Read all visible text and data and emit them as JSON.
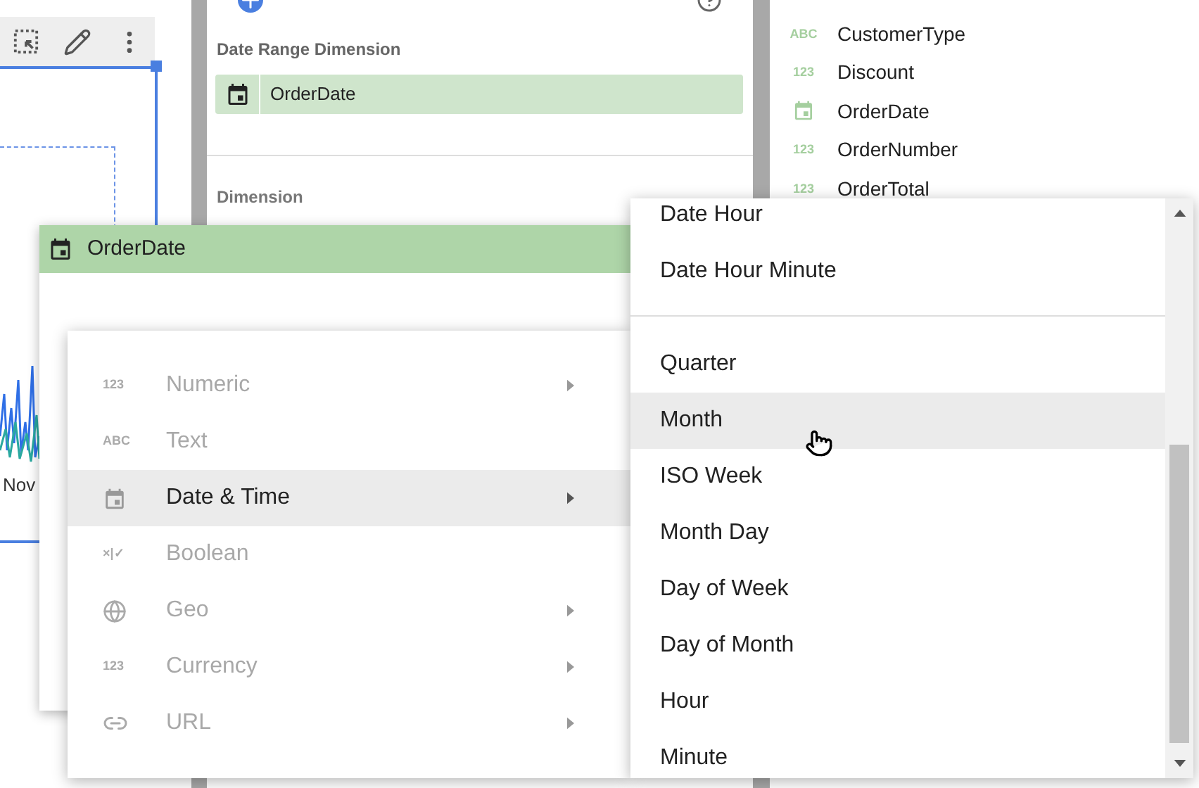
{
  "chart": {
    "axis_label": "Nov"
  },
  "data_panel": {
    "date_range_label": "Date Range Dimension",
    "date_range_value": "OrderDate",
    "dimension_label": "Dimension"
  },
  "fields": [
    {
      "kind": "text",
      "badge": "ABC",
      "name": "CustomerType"
    },
    {
      "kind": "number",
      "badge": "123",
      "name": "Discount"
    },
    {
      "kind": "date",
      "name": "OrderDate"
    },
    {
      "kind": "number",
      "badge": "123",
      "name": "OrderNumber"
    },
    {
      "kind": "number",
      "badge": "123",
      "name": "OrderTotal"
    }
  ],
  "field_popup": {
    "title": "OrderDate"
  },
  "type_menu": [
    {
      "kind": "badge",
      "badge": "123",
      "label": "Numeric",
      "submenu": true,
      "selected": false,
      "disabled": true
    },
    {
      "kind": "badge",
      "badge": "ABC",
      "label": "Text",
      "submenu": false,
      "selected": false,
      "disabled": true
    },
    {
      "kind": "date",
      "label": "Date & Time",
      "submenu": true,
      "selected": true,
      "disabled": false
    },
    {
      "kind": "badge",
      "badge": "×|✓",
      "label": "Boolean",
      "submenu": false,
      "selected": false,
      "disabled": true
    },
    {
      "kind": "geo",
      "label": "Geo",
      "submenu": true,
      "selected": false,
      "disabled": true
    },
    {
      "kind": "badge",
      "badge": "123",
      "label": "Currency",
      "submenu": true,
      "selected": false,
      "disabled": true
    },
    {
      "kind": "link",
      "label": "URL",
      "submenu": true,
      "selected": false,
      "disabled": true
    }
  ],
  "date_submenu": [
    {
      "items": [
        {
          "label": "Date Hour",
          "selected": false
        },
        {
          "label": "Date Hour Minute",
          "selected": false
        }
      ]
    },
    {
      "items": [
        {
          "label": "Quarter",
          "selected": false
        },
        {
          "label": "Month",
          "selected": true
        },
        {
          "label": "ISO Week",
          "selected": false
        },
        {
          "label": "Month Day",
          "selected": false
        },
        {
          "label": "Day of Week",
          "selected": false
        },
        {
          "label": "Day of Month",
          "selected": false
        },
        {
          "label": "Hour",
          "selected": false
        },
        {
          "label": "Minute",
          "selected": false
        }
      ]
    }
  ]
}
